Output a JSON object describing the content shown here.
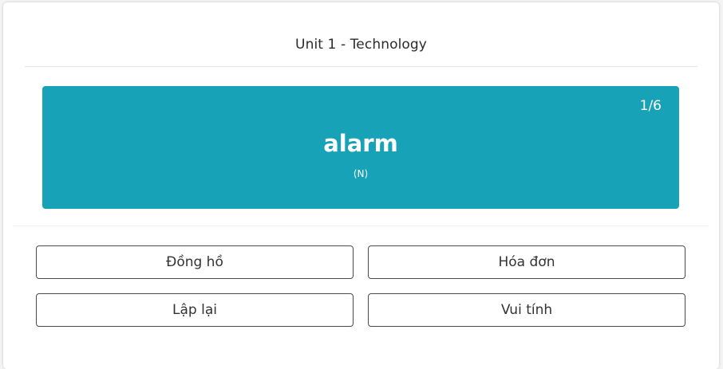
{
  "header": {
    "title": "Unit 1 - Technology"
  },
  "card": {
    "counter": "1/6",
    "word": "alarm",
    "part_of_speech": "(N)",
    "color": "#17a2b8"
  },
  "answers": [
    {
      "label": "Đồng hồ"
    },
    {
      "label": "Hóa đơn"
    },
    {
      "label": "Lập lại"
    },
    {
      "label": "Vui tính"
    }
  ]
}
